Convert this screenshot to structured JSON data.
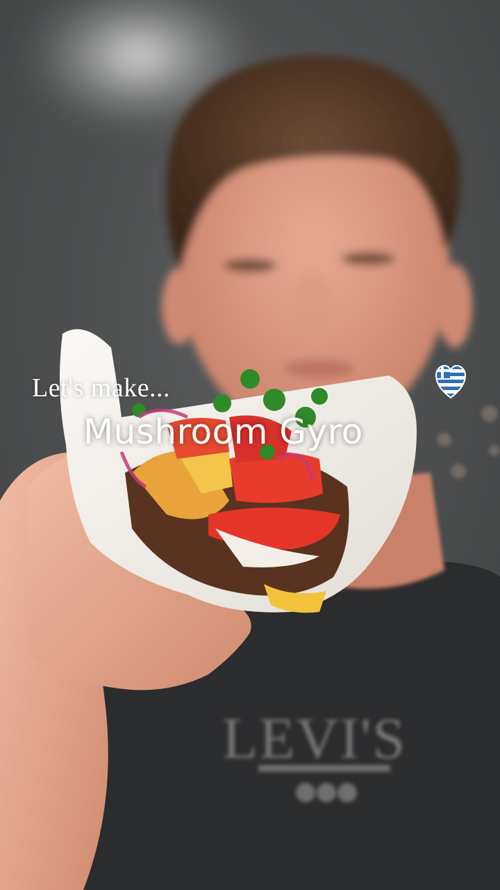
{
  "overlay": {
    "intro_text": "Let's make...",
    "title_text": "Mushroom Gyro"
  },
  "sticker": {
    "icon": "greek-flag-heart-icon"
  },
  "shirt": {
    "logo_text": "Levi's"
  },
  "colors": {
    "background": "#4a4c4d",
    "shirt": "#2b2c2e",
    "caption": "#ffffff",
    "flag_blue": "#2f6fb6"
  }
}
